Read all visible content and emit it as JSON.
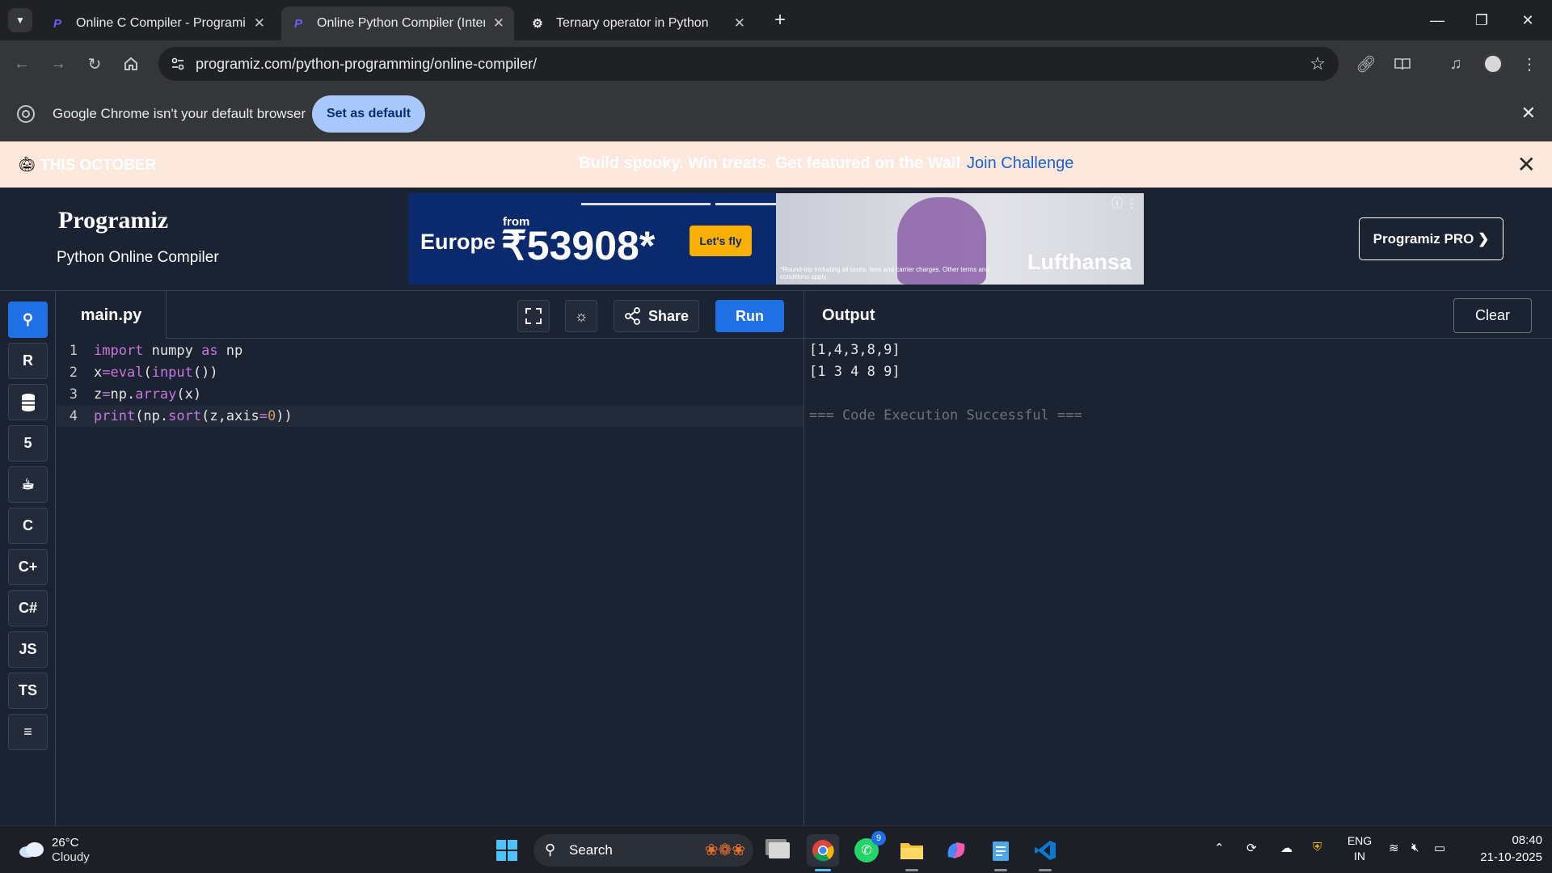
{
  "browser": {
    "tabs": [
      {
        "title": "Online C Compiler - Programiz",
        "active": false
      },
      {
        "title": "Online Python Compiler (Interp",
        "active": true
      },
      {
        "title": "Ternary operator in Python",
        "active": false
      }
    ],
    "url": "programiz.com/python-programming/online-compiler/",
    "infobar": {
      "message": "Google Chrome isn't your default browser",
      "button": "Set as default"
    }
  },
  "promo": {
    "tag": "THIS OCTOBER",
    "text": "Build spooky. Win treats. Get featured on the Wall.",
    "link": "Join Challenge"
  },
  "header": {
    "logo": "Programiz",
    "subtitle": "Python Online Compiler",
    "pro_button": "Programiz PRO ❯"
  },
  "ad": {
    "from": "from",
    "destination": "Europe",
    "price": "₹53908*",
    "cta": "Let's fly",
    "brand": "Lufthansa",
    "fine_print": "*Round-trip including all taxes, fees and carrier charges. Other terms and conditions apply."
  },
  "sidebar": {
    "languages": [
      "python",
      "r",
      "sql",
      "html",
      "java",
      "c",
      "c++",
      "c#",
      "JS",
      "TS",
      "swift"
    ]
  },
  "editor": {
    "filename": "main.py",
    "share_label": "Share",
    "run_label": "Run",
    "lines": [
      {
        "n": "1",
        "code": "import numpy as np"
      },
      {
        "n": "2",
        "code": "x=eval(input())"
      },
      {
        "n": "3",
        "code": "z=np.array(x)"
      },
      {
        "n": "4",
        "code": "print(np.sort(z,axis=0))"
      }
    ]
  },
  "output": {
    "title": "Output",
    "clear_label": "Clear",
    "lines": [
      "[1,4,3,8,9]",
      "[1 3 4 8 9]",
      "",
      "=== Code Execution Successful ==="
    ]
  },
  "taskbar": {
    "temperature": "26°C",
    "condition": "Cloudy",
    "search": "Search",
    "whatsapp_badge": "9",
    "lang_top": "ENG",
    "lang_bottom": "IN",
    "time": "08:40",
    "date": "21-10-2025"
  }
}
